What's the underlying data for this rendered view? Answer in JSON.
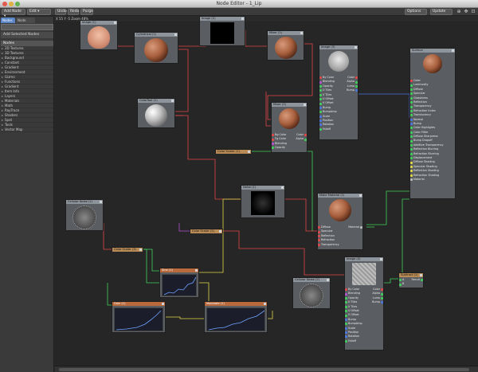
{
  "window": {
    "title": "Node Editor - 1_Lip"
  },
  "toolbar": {
    "add_node": "Add Node",
    "edit": "Edit",
    "undo": "Undo",
    "redo": "Redo",
    "purge": "Purge",
    "options": "Options",
    "update": "Update"
  },
  "left_panel": {
    "tabs": [
      "Nodes",
      "Node Flow"
    ],
    "add_selected": "Add Selected Nodes",
    "nodes_header": "Nodes",
    "categories": [
      "2D Textures",
      "3D Textures",
      "Background",
      "Constant",
      "Gradient",
      "Environment",
      "Gizmo",
      "Functions",
      "Gradient",
      "Item Info",
      "Layers",
      "Materials",
      "Math",
      "RayTrace",
      "Shaders",
      "Spot",
      "Tools",
      "Vector Map"
    ]
  },
  "canvas": {
    "info": "X 55 Y -5 Zoom 48%"
  },
  "nodes": {
    "image_face": "Image (1)",
    "cylindrical": "Cylindrical (1)",
    "black_preview": "Image (2)",
    "mixer1": "Mixer (1)",
    "image_bw": "Image (3)",
    "surface": "Surface",
    "colortool": "ColorTool (1)",
    "mixer2": "Mixer (2)",
    "color_scalar1": "Color Scalar (1)",
    "noise_node": "Noise (1)",
    "make_material": "Make Material (1)",
    "cellular_noise1": "Cellular Noise (1)",
    "color_scalar2": "Color Scalar (2)",
    "color_scalar3": "Color Scalar (3)",
    "ave_node": "Sine (1)",
    "cellular_noise2": "Cellular Noise (2)",
    "image4": "Image (4)",
    "subtract": "Subtract (1)",
    "gain_node": "Gain (1)",
    "modulate": "Modulate (1)"
  },
  "image_ports": [
    "By Color",
    "Blending",
    "Opacity",
    "U Tiles",
    "V Tiles",
    "U Offset",
    "V Offset",
    "Bump",
    "BumpAmp",
    "Scale",
    "Position",
    "Rotation",
    "Falloff"
  ],
  "image_outputs": [
    "Color",
    "Alpha",
    "Luma",
    "Bump"
  ],
  "mixer_ports": [
    "Bg Color",
    "Fg Color",
    "Blending",
    "Opacity"
  ],
  "mixer_outputs": [
    "Color",
    "Alpha"
  ],
  "make_material_ports": [
    "Diffuse",
    "Specular",
    "Reflection",
    "Refraction",
    "Transparency"
  ],
  "make_material_output": "Material",
  "subtract_ports": [
    "A",
    "B"
  ],
  "subtract_output": "Result",
  "surface_ports": [
    "Color",
    "Luminosity",
    "Diffuse",
    "Specular",
    "Glossiness",
    "Reflection",
    "Transparency",
    "Refraction Index",
    "Translucency",
    "Normal",
    "Bump",
    "Color Highlights",
    "Color Filter",
    "Diffuse Sharpness",
    "Bump Dropoff",
    "Additive Transparency",
    "Reflection Blurring",
    "Refraction Blurring",
    "Displacement",
    "Diffuse Shading",
    "Specular Shading",
    "Reflection Shading",
    "Refraction Shading",
    "Material"
  ],
  "colors": {
    "port_red": "#e24848",
    "port_green": "#3fcf5a",
    "port_blue": "#4a78e0",
    "port_purple": "#b452d0",
    "port_yellow": "#e0d84a",
    "port_grey": "#bbbbbb"
  }
}
